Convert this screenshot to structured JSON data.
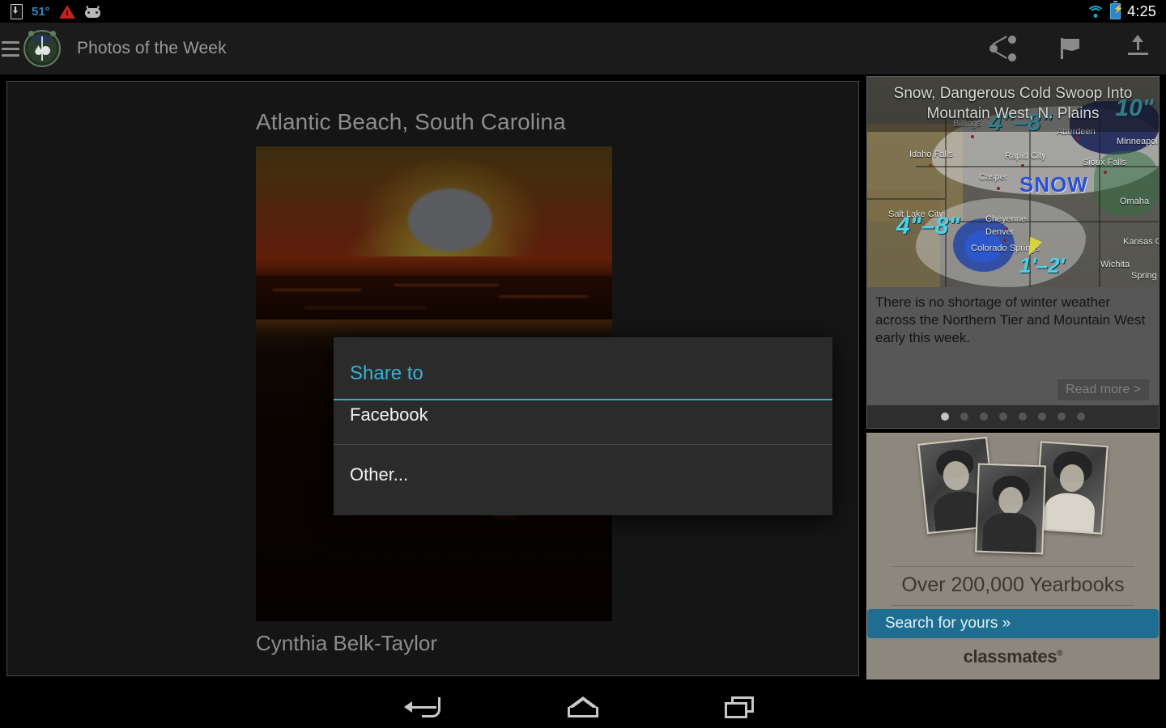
{
  "statusbar": {
    "download_icon": "download-icon",
    "temperature": "51°",
    "warning_icon": "warning-triangle-icon",
    "bug_icon": "android-bug-icon",
    "wifi_icon": "wifi-icon",
    "battery_icon": "battery-charging-icon",
    "clock": "4:25"
  },
  "appbar": {
    "menu_icon": "hamburger-menu-icon",
    "logo_icon": "weatherbug-logo-icon",
    "title": "Photos of the Week",
    "actions": [
      {
        "name": "share-icon",
        "label": "Share"
      },
      {
        "name": "flag-icon",
        "label": "Flag"
      },
      {
        "name": "upload-icon",
        "label": "Upload"
      }
    ]
  },
  "photo": {
    "title": "Atlantic Beach, South Carolina",
    "author": "Cynthia Belk-Taylor"
  },
  "dialog": {
    "title": "Share to",
    "accent_color": "#34aad1",
    "items": [
      {
        "label": "Facebook"
      },
      {
        "label": "Other..."
      }
    ]
  },
  "sidebar": {
    "weather_card": {
      "headline": "Snow, Dangerous Cold Swoop Into Mountain West, N. Plains",
      "body": "There is no shortage of winter weather across the Northern Tier and Mountain West early this week.",
      "read_more": "Read more >",
      "map_labels": {
        "cities": [
          "Billings",
          "Aberdeen",
          "Minneapol",
          "Idaho Falls",
          "Rapid City",
          "Sioux Falls",
          "Casper",
          "Omaha",
          "Salt Lake City",
          "Cheyenne",
          "Denver",
          "Colorado Springs",
          "Wichita",
          "Kansas City",
          "Spring"
        ],
        "snow_amounts": [
          "4\"–8\"",
          "10\"",
          "4\"–8\"",
          "1'–2'"
        ],
        "overlay_word": "SNOW"
      },
      "dots_total": 8,
      "dots_active_index": 0
    },
    "ad": {
      "headline": "Over 200,000 Yearbooks",
      "button": "Search for yours »",
      "brand": "classmates",
      "brand_mark": "®"
    }
  },
  "navbar": {
    "back_icon": "back-icon",
    "home_icon": "home-icon",
    "recents_icon": "recent-apps-icon"
  }
}
